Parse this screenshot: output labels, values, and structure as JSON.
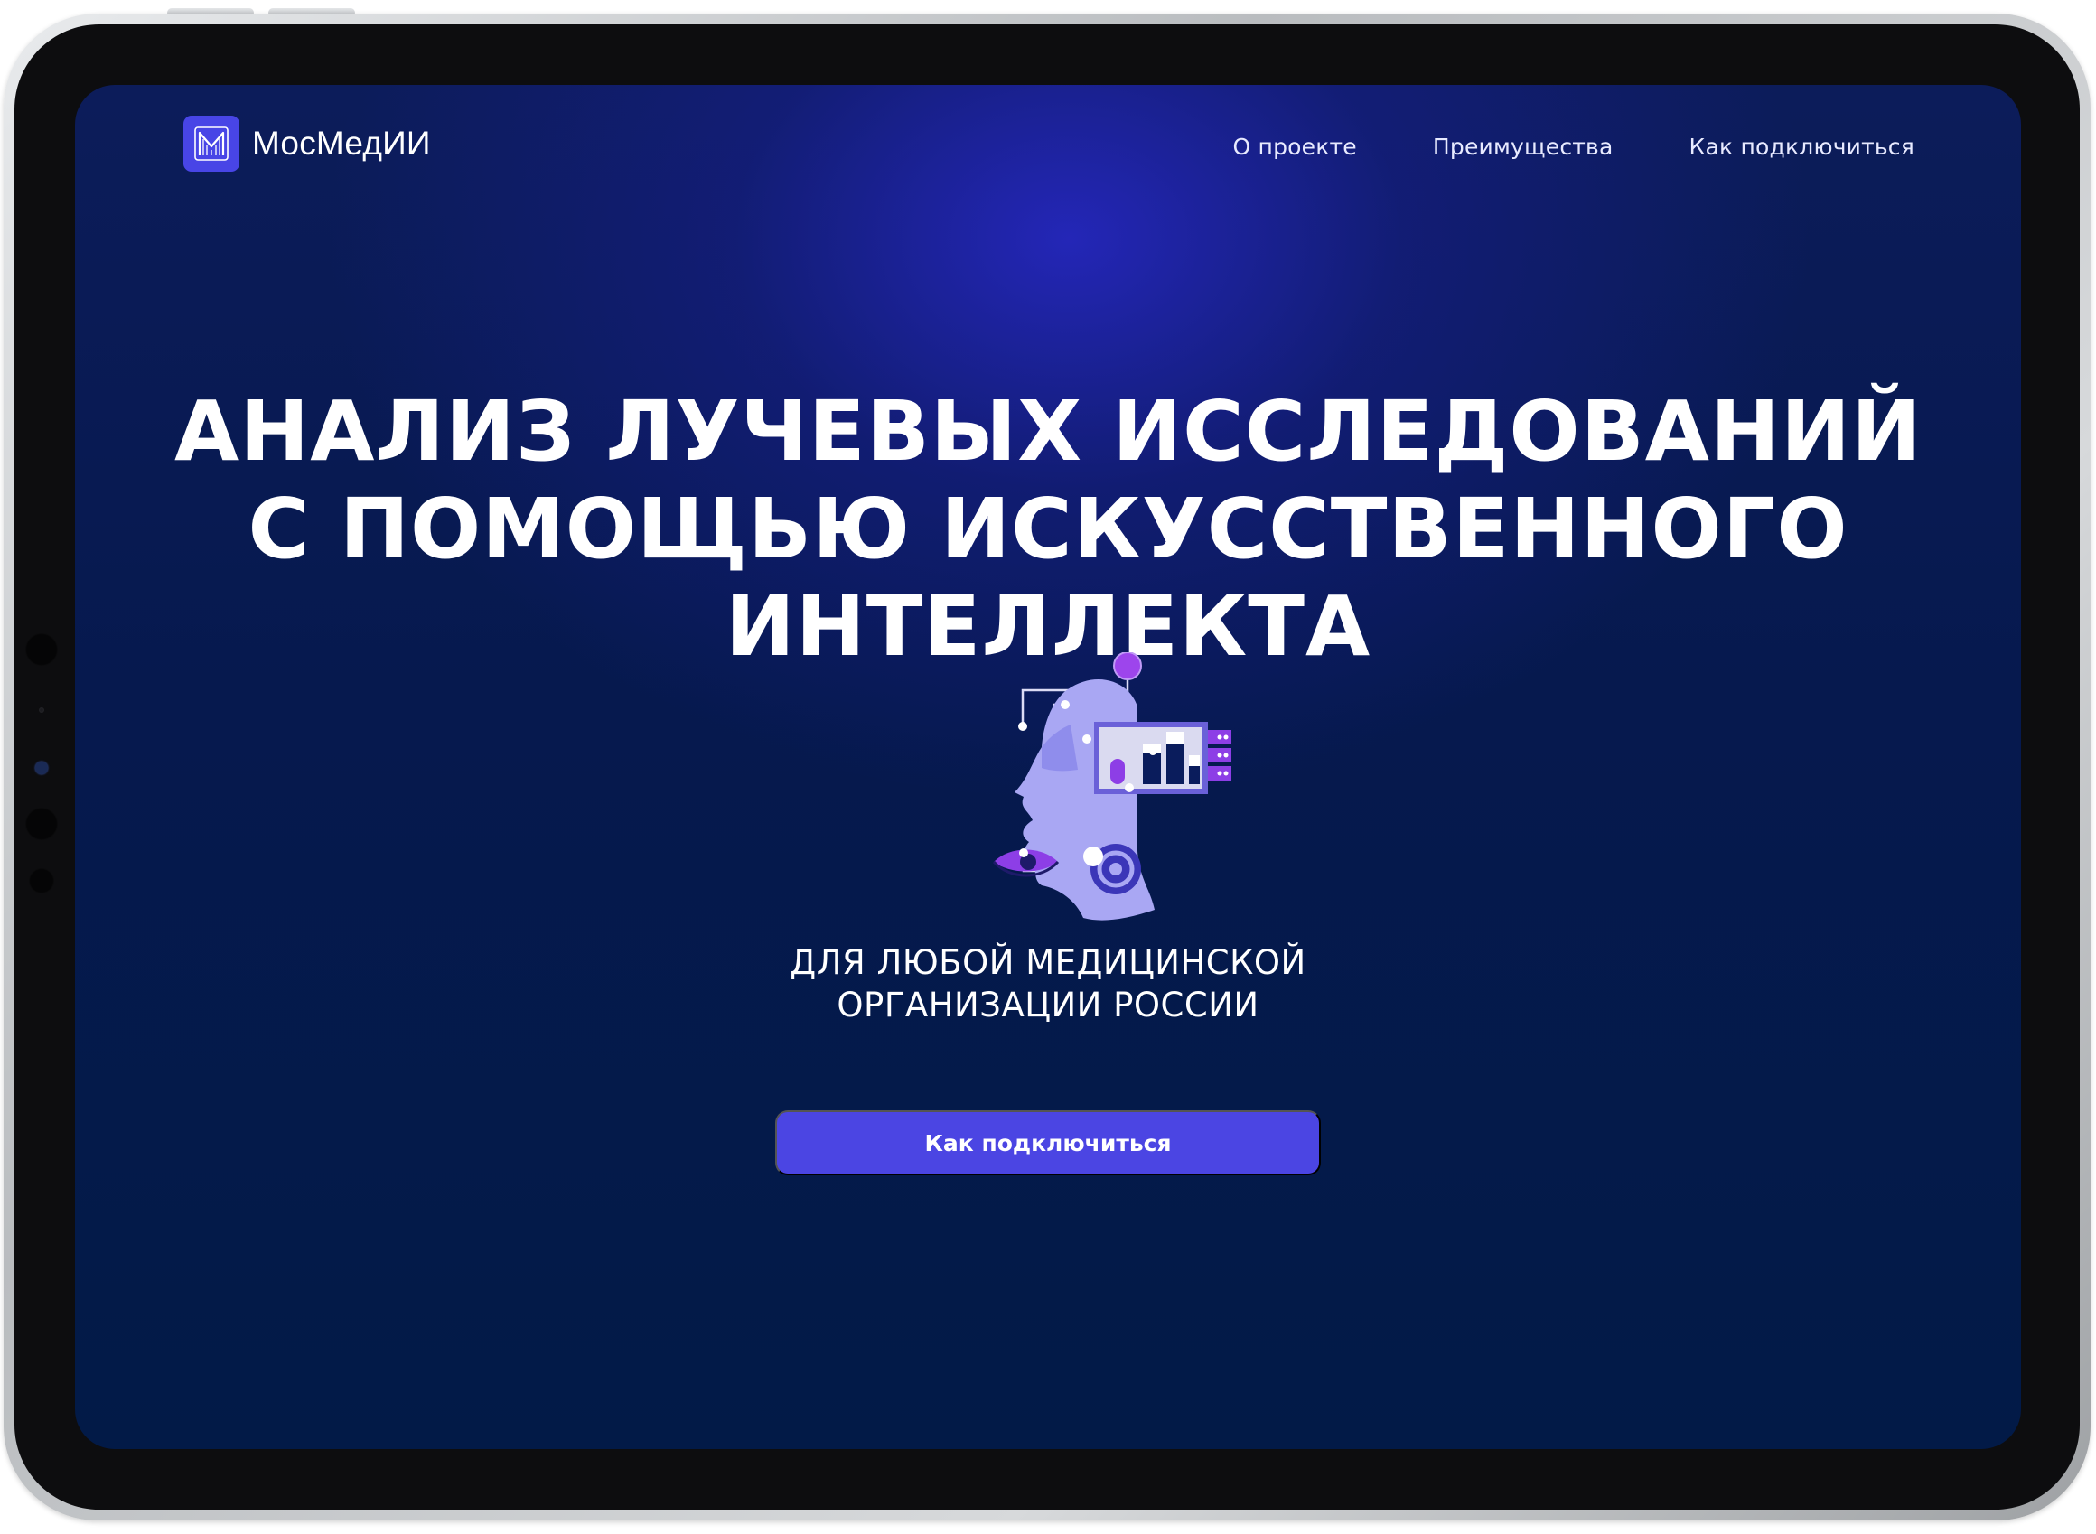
{
  "header": {
    "logo_text": "МосМедИИ",
    "logo_icon": "m-monogram-icon",
    "nav": [
      {
        "label": "О проекте"
      },
      {
        "label": "Преимущества"
      },
      {
        "label": "Как подключиться"
      }
    ]
  },
  "hero": {
    "title_lines": [
      "АНАЛИЗ ЛУЧЕВЫХ ИССЛЕДОВАНИЙ",
      "С ПОМОЩЬЮ ИСКУССТВЕННОГО",
      "ИНТЕЛЛЕКТА"
    ],
    "subtitle_lines": [
      "ДЛЯ ЛЮБОЙ МЕДИЦИНСКОЙ",
      "ОРГАНИЗАЦИИ РОССИИ"
    ],
    "cta_label": "Как подключиться",
    "illustration_icon": "ai-head-illustration"
  },
  "colors": {
    "accent": "#4b45e3",
    "background_dark": "#021a47",
    "illustration_lavender": "#a9a7f3",
    "illustration_purple": "#8d3ee6"
  }
}
